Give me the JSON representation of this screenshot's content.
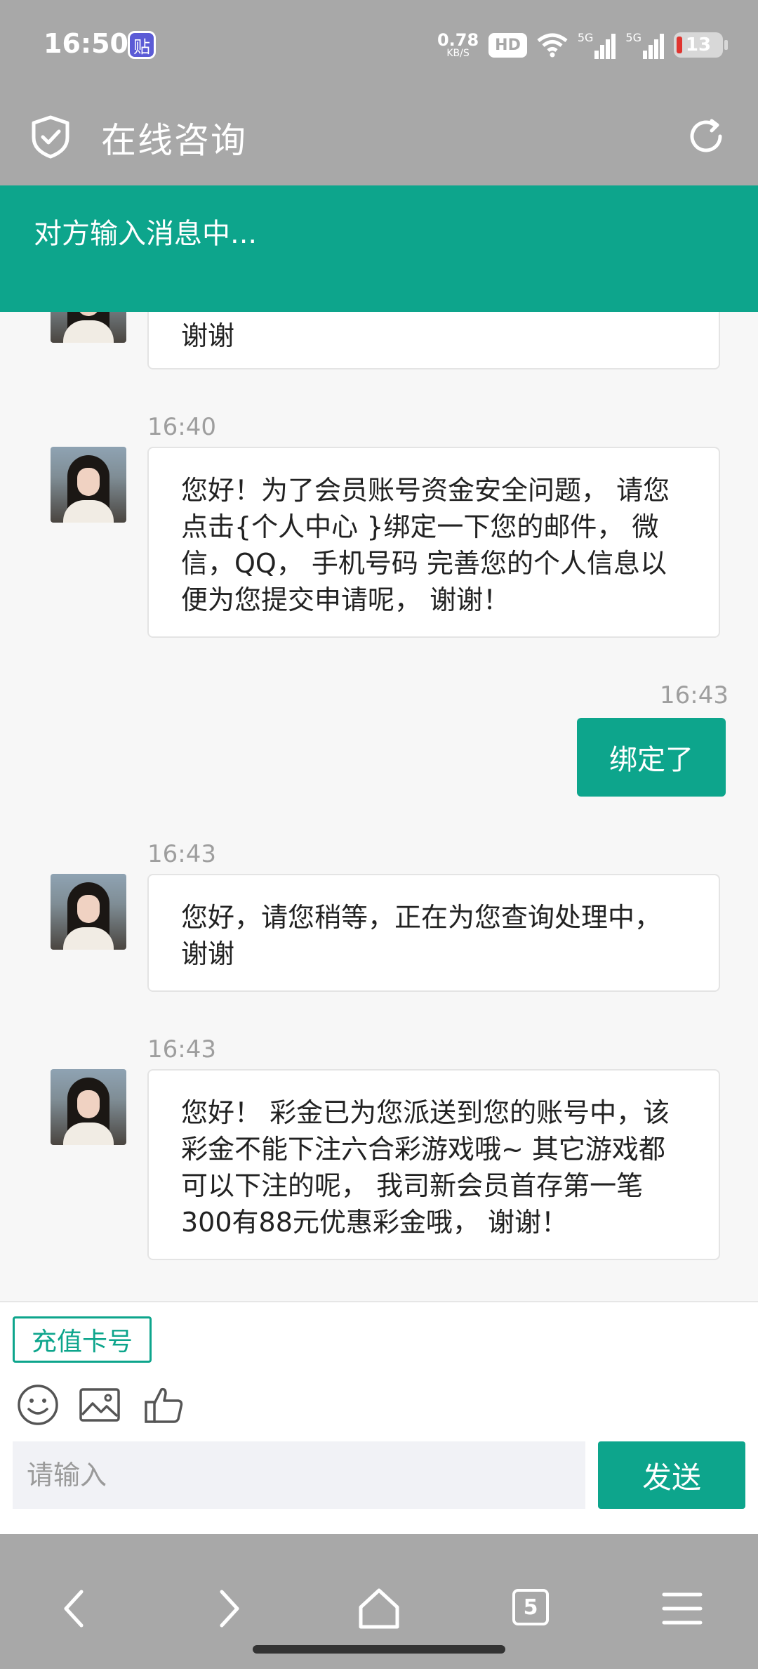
{
  "status_bar": {
    "time": "16:50",
    "app_badge": "贴",
    "net_speed_value": "0.78",
    "net_speed_unit": "KB/S",
    "hd_label": "HD",
    "signal_label_1": "5G",
    "signal_label_2": "5G",
    "battery": "13"
  },
  "header": {
    "title": "在线咨询"
  },
  "typing_banner": {
    "text": "对方输入消息中..."
  },
  "messages": [
    {
      "side": "left",
      "time": "",
      "text": "谢谢"
    },
    {
      "side": "left",
      "time": "16:40",
      "text": "您好！为了会员账号资金安全问题， 请您点击{个人中心 }绑定一下您的邮件， 微信，QQ， 手机号码 完善您的个人信息以便为您提交申请呢， 谢谢！"
    },
    {
      "side": "right",
      "time": "16:43",
      "text": "绑定了"
    },
    {
      "side": "left",
      "time": "16:43",
      "text": "您好，请您稍等，正在为您查询处理中，谢谢"
    },
    {
      "side": "left",
      "time": "16:43",
      "text": "您好！ 彩金已为您派送到您的账号中，该彩金不能下注六合彩游戏哦~ 其它游戏都可以下注的呢， 我司新会员首存第一笔300有88元优惠彩金哦， 谢谢！"
    }
  ],
  "composer": {
    "recharge_label": "充值卡号",
    "input_placeholder": "请输入",
    "send_label": "发送",
    "tools": [
      "emoji-icon",
      "image-icon",
      "thumbs-up-icon"
    ]
  },
  "nav_bar": {
    "tab_count": "5",
    "icons": [
      "back-icon",
      "forward-icon",
      "home-icon",
      "tabs-icon",
      "menu-icon"
    ]
  },
  "colors": {
    "accent": "#0da58c",
    "header_bg": "#a8a8a8",
    "chat_bg": "#f7f7f7"
  }
}
